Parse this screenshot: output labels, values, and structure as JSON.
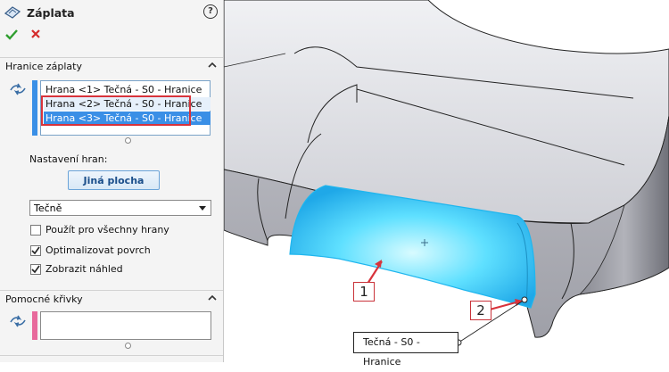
{
  "panel": {
    "title": "Záplata",
    "help": "?",
    "section_boundary": "Hranice záplaty",
    "edges": [
      "Hrana <1> Tečná - S0 - Hranice",
      "Hrana <2> Tečná - S0 - Hranice",
      "Hrana <3> Tečná - S0 - Hranice"
    ],
    "edge_settings_label": "Nastavení hran:",
    "alt_face_button": "Jiná plocha",
    "tangency_select": "Tečně",
    "apply_all": "Použít pro všechny hrany",
    "optimize": "Optimalizovat povrch",
    "preview": "Zobrazit náhled",
    "section_curves": "Pomocné křivky"
  },
  "viewport": {
    "callout_1": "1",
    "callout_2": "2",
    "tag_label": "Tečná - S0 - Hranice"
  },
  "colors": {
    "accent": "#3a8fe6",
    "callout_red": "#d8333b",
    "patch_cyan": "#3fd6ff"
  }
}
